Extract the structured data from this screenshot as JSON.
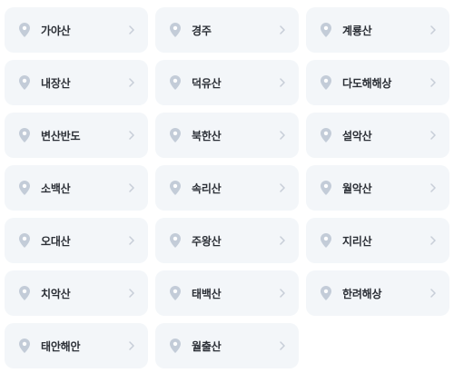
{
  "regions": [
    {
      "label": "가야산"
    },
    {
      "label": "경주"
    },
    {
      "label": "계룡산"
    },
    {
      "label": "내장산"
    },
    {
      "label": "덕유산"
    },
    {
      "label": "다도해해상"
    },
    {
      "label": "변산반도"
    },
    {
      "label": "북한산"
    },
    {
      "label": "설악산"
    },
    {
      "label": "소백산"
    },
    {
      "label": "속리산"
    },
    {
      "label": "월악산"
    },
    {
      "label": "오대산"
    },
    {
      "label": "주왕산"
    },
    {
      "label": "지리산"
    },
    {
      "label": "치악산"
    },
    {
      "label": "태백산"
    },
    {
      "label": "한려해상"
    },
    {
      "label": "태안해안"
    },
    {
      "label": "월출산"
    }
  ],
  "colors": {
    "card_bg": "#f3f6f9",
    "pin": "#c3ccd8",
    "chevron": "#c7ced8",
    "text": "#2b2f36"
  },
  "icons": {
    "pin": "location-pin-icon",
    "chevron": "chevron-right-icon"
  }
}
